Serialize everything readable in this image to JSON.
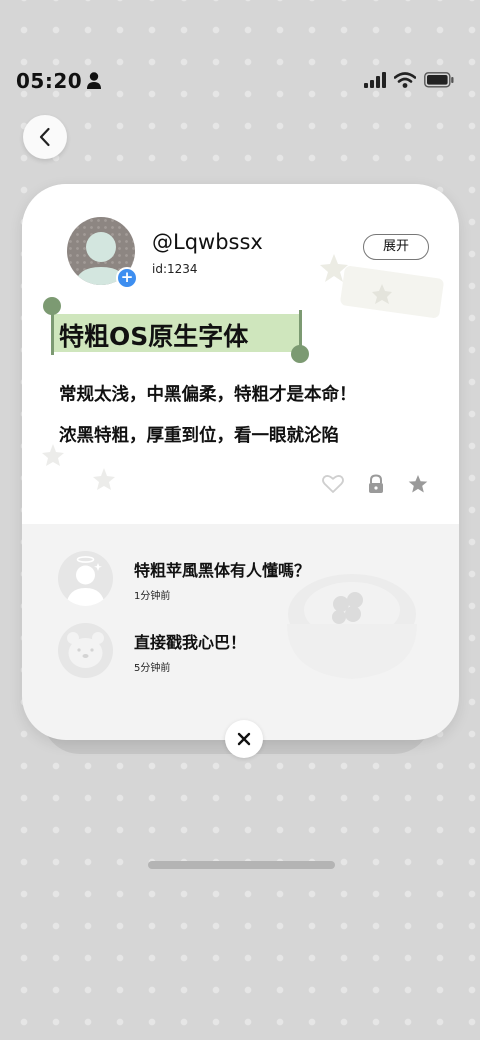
{
  "status_bar": {
    "time": "05:20",
    "icons": [
      "person-icon",
      "cellular-signal-icon",
      "wifi-icon",
      "battery-icon"
    ]
  },
  "nav": {
    "back_icon": "chevron-left-icon"
  },
  "post": {
    "username": "@Lqwbssx",
    "user_id": "id:1234",
    "expand_label": "展开",
    "title": "特粗OS原生字体",
    "body_lines": [
      "常规太浅，中黑偏柔，特粗才是本命！",
      "浓黑特粗，厚重到位，看一眼就沦陷"
    ],
    "actions": [
      "heart-icon",
      "lock-icon",
      "star-icon"
    ]
  },
  "comments": [
    {
      "text": "特粗苹風黑体有人懂嗎？",
      "time": "1分钟前",
      "avatar": "angel-avatar"
    },
    {
      "text": "直接戳我心巴！",
      "time": "5分钟前",
      "avatar": "bear-avatar"
    }
  ],
  "colors": {
    "highlight": "#cfe6bd",
    "selection_handle": "#7c9a72",
    "add_badge": "#3d8ef0"
  }
}
